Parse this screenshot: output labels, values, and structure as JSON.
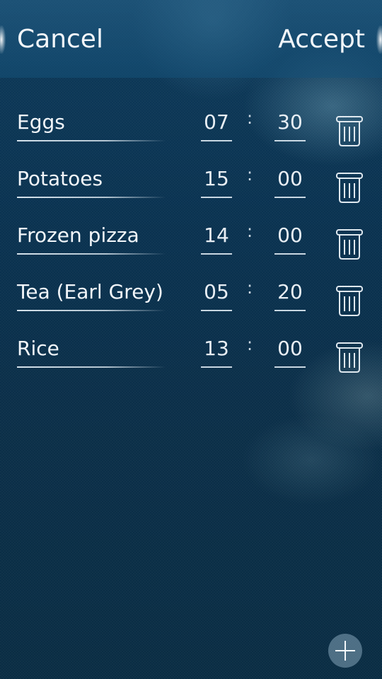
{
  "header": {
    "cancel_label": "Cancel",
    "accept_label": "Accept"
  },
  "items": [
    {
      "name": "Eggs",
      "minutes": "07",
      "seconds": "30"
    },
    {
      "name": "Potatoes",
      "minutes": "15",
      "seconds": "00"
    },
    {
      "name": "Frozen pizza",
      "minutes": "14",
      "seconds": "00"
    },
    {
      "name": "Tea (Earl Grey)",
      "minutes": "05",
      "seconds": "20"
    },
    {
      "name": "Rice",
      "minutes": "13",
      "seconds": "00"
    }
  ],
  "separator": ":",
  "icons": {
    "delete": "trash-icon",
    "add": "plus-icon"
  },
  "colors": {
    "background": "#0b2f49",
    "header": "#1f5a80",
    "text": "#f2f6fa"
  }
}
